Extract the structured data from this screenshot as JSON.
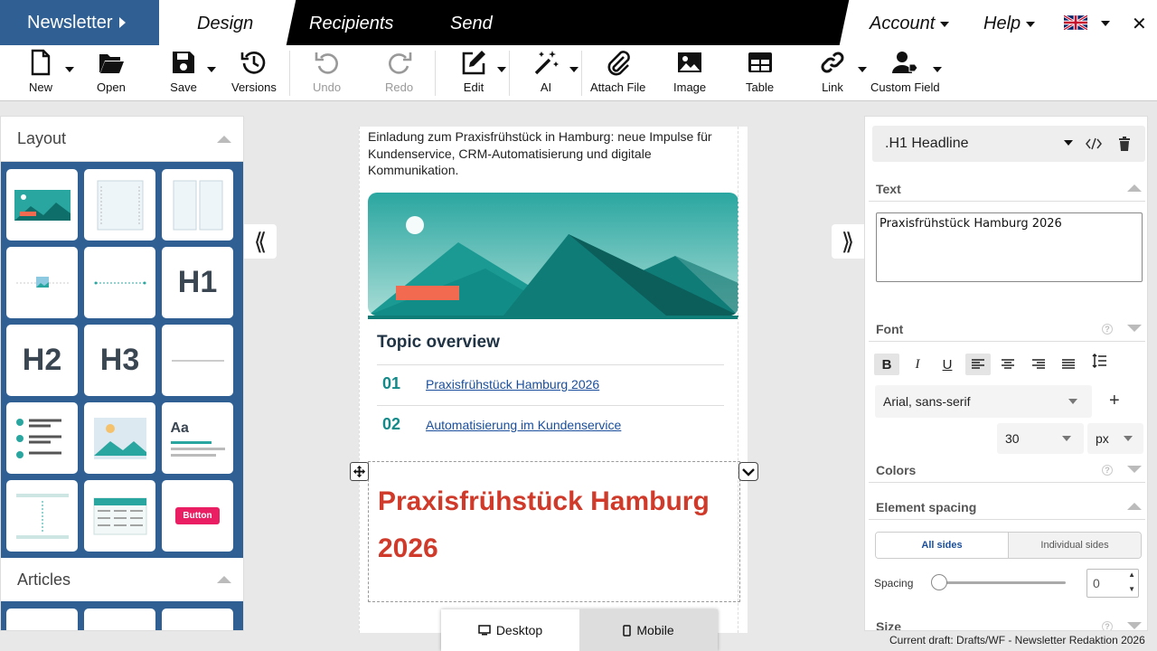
{
  "nav": {
    "brand": "Newsletter",
    "tabs": [
      "Design",
      "Recipients",
      "Send"
    ],
    "account": "Account",
    "help": "Help",
    "close": "✕"
  },
  "toolbar": {
    "new": "New",
    "open": "Open",
    "save": "Save",
    "versions": "Versions",
    "undo": "Undo",
    "redo": "Redo",
    "edit": "Edit",
    "ai": "AI",
    "attach": "Attach File",
    "image": "Image",
    "table": "Table",
    "link": "Link",
    "custom_field": "Custom Field"
  },
  "left_panel": {
    "layout_title": "Layout",
    "articles_title": "Articles",
    "tiles": {
      "h1": "H1",
      "h2": "H2",
      "h3": "H3",
      "aa": "Aa",
      "button": "Button"
    }
  },
  "email": {
    "intro": "Einladung zum Praxisfrühstück in Hamburg: neue Impulse für Kundenservice, CRM-Automatisierung und digitale Kommunikation.",
    "topic_title": "Topic overview",
    "topics": [
      {
        "num": "01",
        "label": "Praxisfrühstück Hamburg 2026"
      },
      {
        "num": "02",
        "label": "Automatisierung im Kundenservice"
      }
    ],
    "h1": "Praxisfrühstück Hamburg 2026"
  },
  "view_switch": {
    "desktop": "Desktop",
    "mobile": "Mobile",
    "active": "mobile"
  },
  "status": "Current draft: Drafts/WF - Newsletter Redaktion 2026",
  "right_panel": {
    "element": ".H1 Headline",
    "text_section": "Text",
    "text_value": "Praxisfrühstück Hamburg 2026",
    "font_section": "Font",
    "font_family": "Arial, sans-serif",
    "font_size": "30",
    "font_unit": "px",
    "colors_section": "Colors",
    "spacing_section": "Element spacing",
    "all_sides": "All sides",
    "individual_sides": "Individual sides",
    "spacing_label": "Spacing",
    "spacing_value": "0",
    "size_section": "Size"
  },
  "colors": {
    "brand_blue": "#2f5f93",
    "headline_red": "#d03a2a",
    "teal": "#138a8a"
  }
}
